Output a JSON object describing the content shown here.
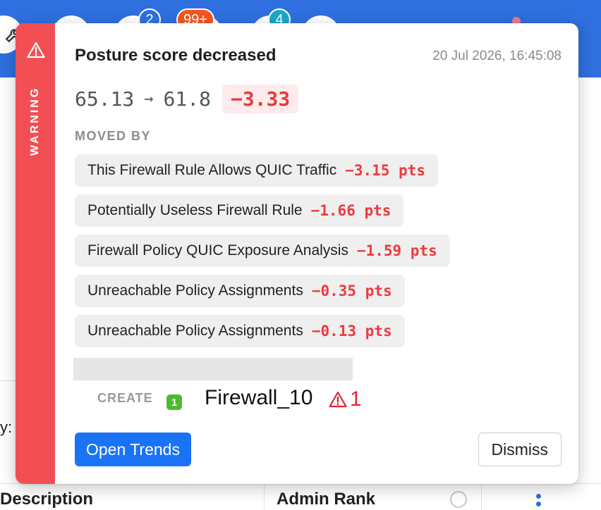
{
  "toolbar": {
    "badges": [
      {
        "label": "2",
        "color": "#2f6fdf"
      },
      {
        "label": "99+",
        "color": "#f2571f"
      },
      {
        "label": "4",
        "color": "#19a8c7"
      }
    ]
  },
  "background": {
    "field_label": "y:",
    "table_columns": [
      "Description",
      "Admin Rank"
    ]
  },
  "notification": {
    "severity": "WARNING",
    "title": "Posture score decreased",
    "timestamp": "20 Jul 2026, 16:45:08",
    "score": {
      "from": "65.13",
      "arrow": "→",
      "to": "61.8",
      "delta": "−3.33"
    },
    "moved_by_label": "MOVED BY",
    "contributors": [
      {
        "name": "This Firewall Rule Allows QUIC Traffic",
        "points": "−3.15 pts"
      },
      {
        "name": "Potentially Useless Firewall Rule",
        "points": "−1.66 pts"
      },
      {
        "name": "Firewall Policy QUIC Exposure Analysis",
        "points": "−1.59 pts"
      },
      {
        "name": "Unreachable Policy Assignments",
        "points": "−0.35 pts"
      },
      {
        "name": "Unreachable Policy Assignments",
        "points": "−0.13 pts"
      }
    ],
    "change": {
      "action": "CREATE",
      "count": "1",
      "object": "Firewall_10",
      "issue_count": "1"
    },
    "actions": {
      "primary": "Open Trends",
      "secondary": "Dismiss"
    }
  },
  "colors": {
    "accent": "#1a73f5",
    "warning": "#f24f55",
    "negative": "#ee3a3f",
    "success": "#4cba2e"
  }
}
